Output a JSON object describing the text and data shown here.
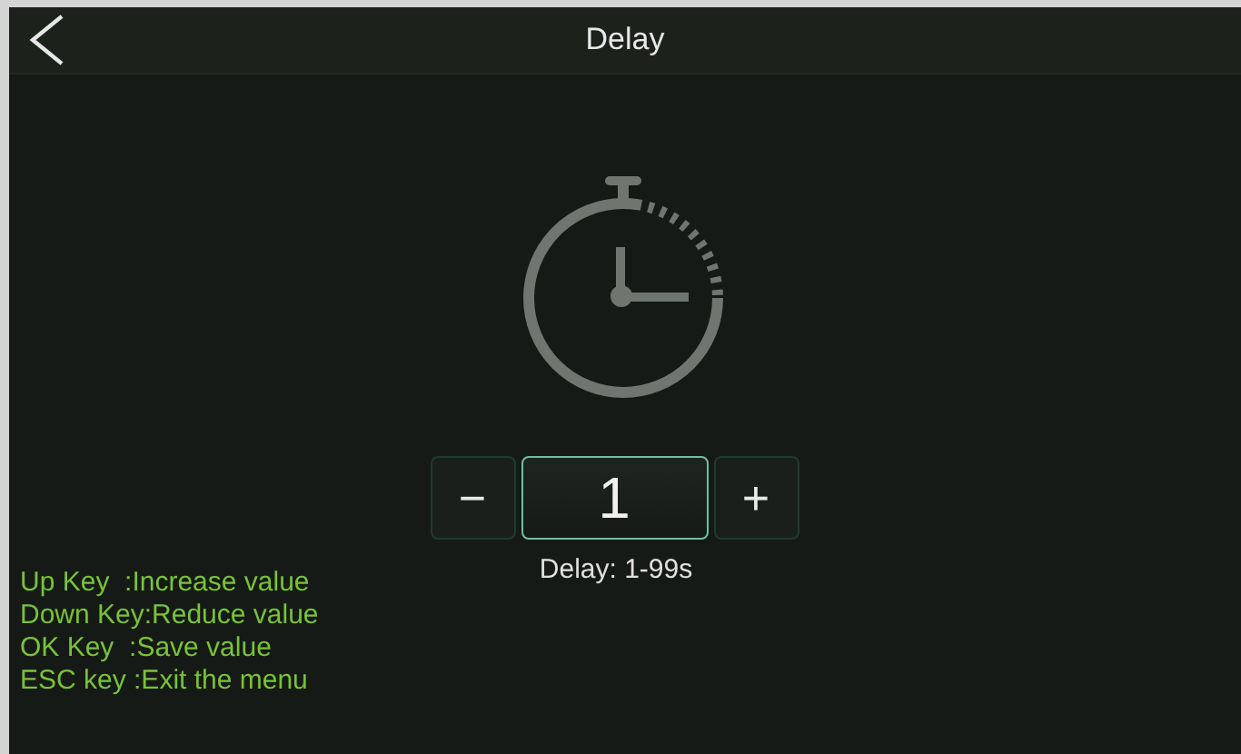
{
  "header": {
    "title": "Delay"
  },
  "stepper": {
    "minus": "−",
    "value": "1",
    "plus": "+"
  },
  "caption": "Delay: 1-99s",
  "help": [
    "Up Key  :Increase value",
    "Down Key:Reduce value",
    "OK Key  :Save value",
    "ESC key :Exit the menu"
  ]
}
